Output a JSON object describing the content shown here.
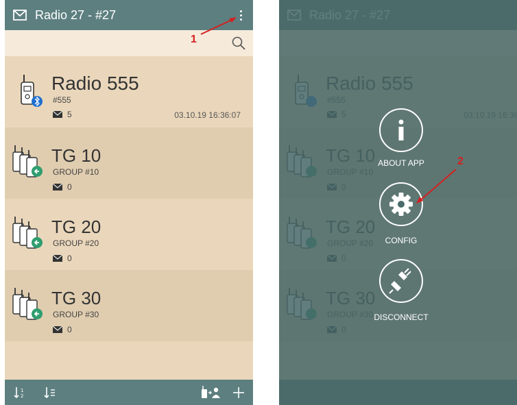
{
  "app": {
    "title": "Radio 27 - #27"
  },
  "contacts": [
    {
      "name": "Radio 555",
      "sub": "#555",
      "messages": "5",
      "timestamp": "03.10.19 16:36:07",
      "kind": "radio",
      "badge": "bluetooth-icon"
    },
    {
      "name": "TG 10",
      "sub": "GROUP #10",
      "messages": "0",
      "timestamp": "",
      "kind": "group",
      "badge": "arrow-left-icon"
    },
    {
      "name": "TG 20",
      "sub": "GROUP #20",
      "messages": "0",
      "timestamp": "",
      "kind": "group",
      "badge": "arrow-left-icon"
    },
    {
      "name": "TG 30",
      "sub": "GROUP #30",
      "messages": "0",
      "timestamp": "",
      "kind": "group",
      "badge": "arrow-left-icon"
    }
  ],
  "menu": {
    "about_label": "ABOUT APP",
    "config_label": "CONFIG",
    "disconnect_label": "DISCONNECT"
  },
  "annotations": {
    "one": "1",
    "two": "2"
  },
  "colors": {
    "appbar": "#5d7f80",
    "row_light": "#ead7bb",
    "row_dark": "#e0cdb0",
    "search_bg": "#f6ebdb",
    "bluetooth_badge": "#1e6fd0",
    "group_badge": "#2f9e6e",
    "annotation": "#d42020"
  }
}
